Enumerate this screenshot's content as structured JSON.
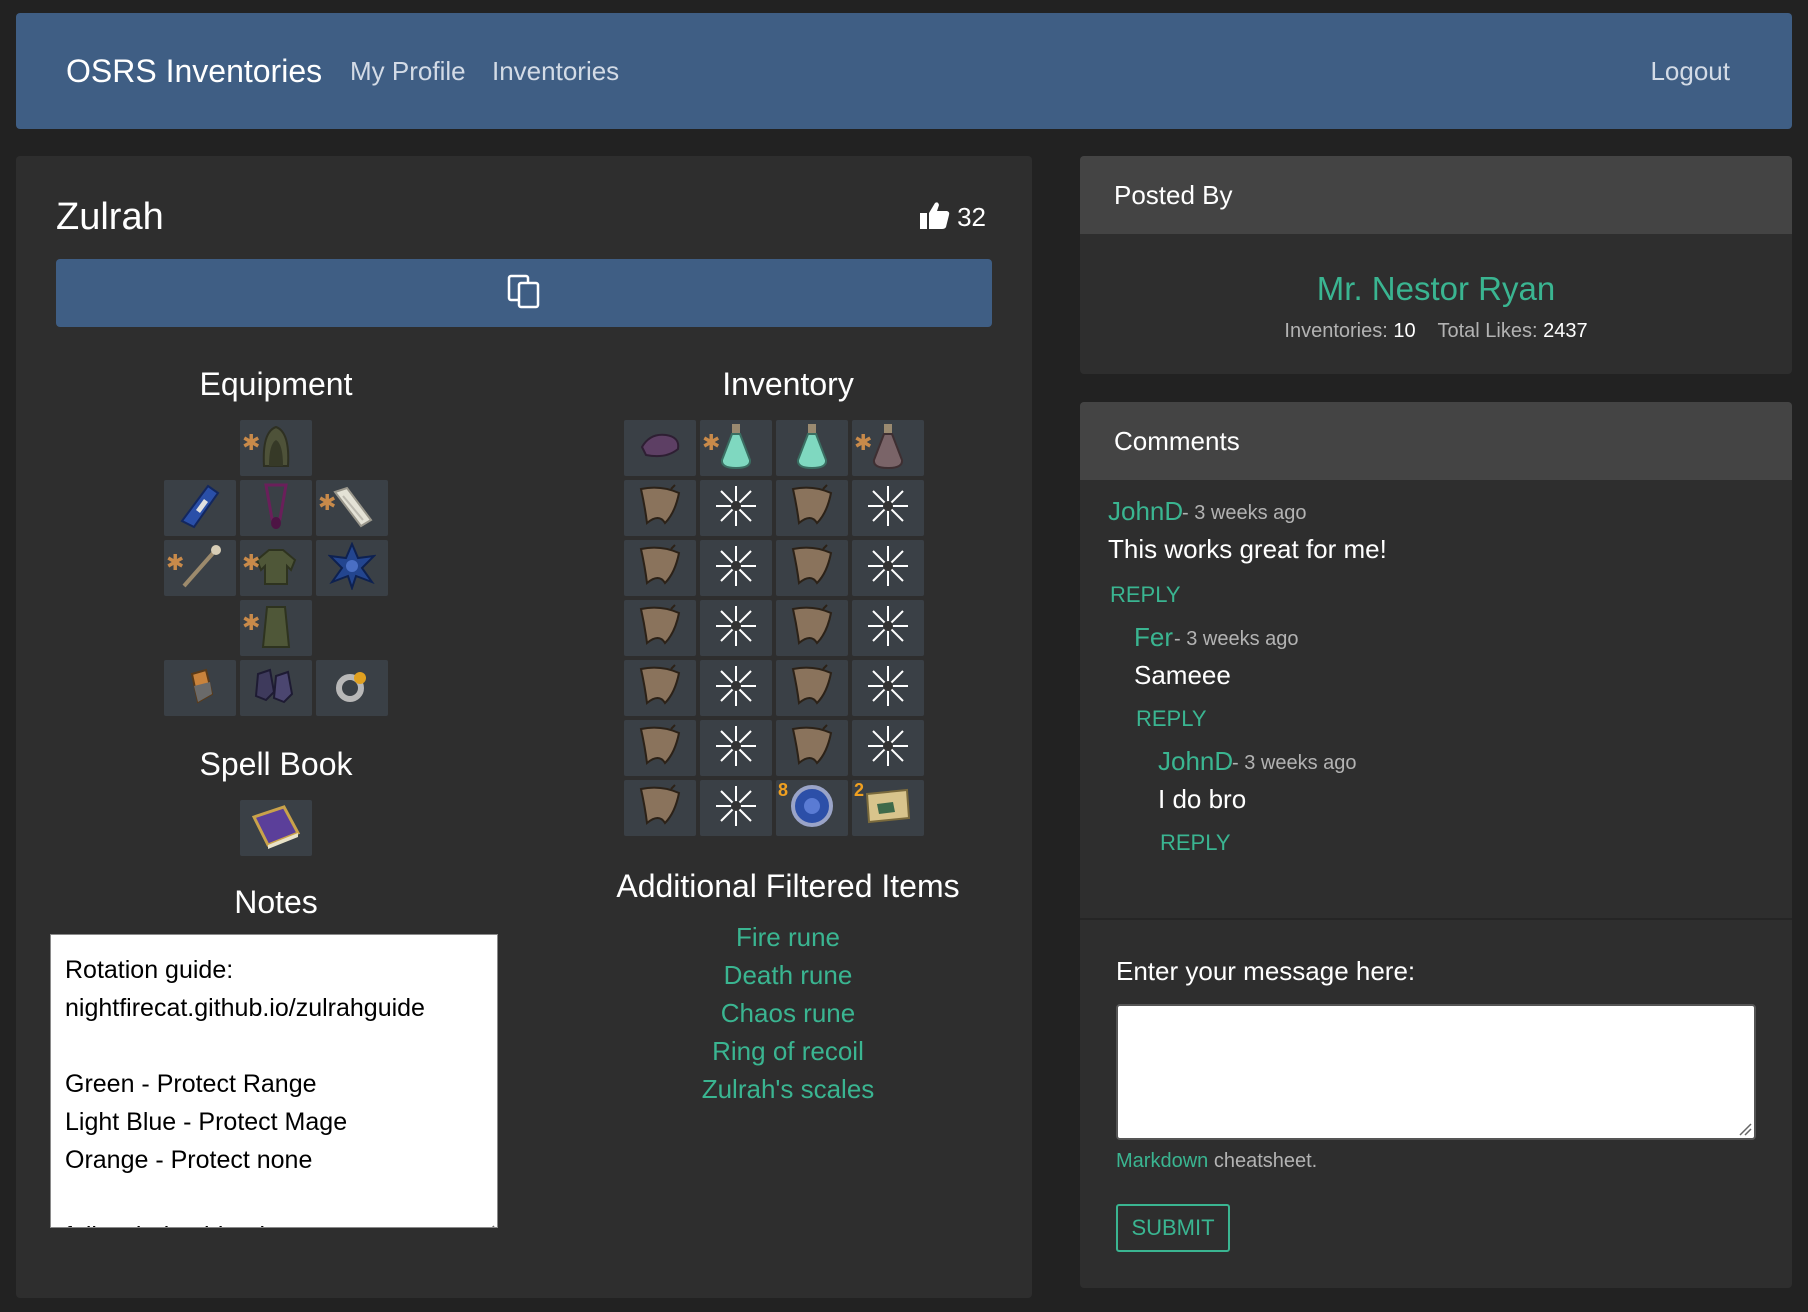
{
  "navbar": {
    "brand": "OSRS Inventories",
    "links": [
      "My Profile",
      "Inventories"
    ],
    "logout": "Logout"
  },
  "inventory": {
    "title": "Zulrah",
    "likes": "32",
    "sections": {
      "equipment": "Equipment",
      "inventory": "Inventory",
      "spellbook": "Spell Book",
      "notes": "Notes",
      "additional": "Additional Filtered Items"
    },
    "slot_quantities": [
      "8",
      "2"
    ],
    "notes_lines": [
      "Rotation guide:",
      "nightfirecat.github.io/zulrahguide",
      "",
      "Green -  Protect Range",
      "Light Blue - Protect Mage",
      "Orange - Protect none",
      "",
      "follow jad strider tip"
    ],
    "additional_items": [
      "Fire rune",
      "Death rune",
      "Chaos rune",
      "Ring of recoil",
      "Zulrah's scales"
    ]
  },
  "posted_by": {
    "header": "Posted By",
    "name": "Mr. Nestor Ryan",
    "inventories_label": "Inventories:",
    "inventories_count": "10",
    "likes_label": "Total Likes:",
    "likes_count": "2437"
  },
  "comments": {
    "header": "Comments",
    "items": [
      {
        "author": "JohnD",
        "time": "- 3 weeks ago",
        "body": "This works great for me!",
        "reply": "REPLY"
      },
      {
        "author": "Fer",
        "time": "- 3 weeks ago",
        "body": "Sameee",
        "reply": "REPLY"
      },
      {
        "author": "JohnD",
        "time": "- 3 weeks ago",
        "body": "I do bro",
        "reply": "REPLY"
      }
    ],
    "form_label": "Enter your message here:",
    "markdown_link": "Markdown",
    "markdown_suffix": " cheatsheet.",
    "submit": "SUBMIT"
  },
  "colors": {
    "navbar": "#3f5e84",
    "background": "#222222",
    "card": "#2e2e2e",
    "card_header": "#444444",
    "accent": "#3ab591",
    "slot": "#3a4046"
  }
}
